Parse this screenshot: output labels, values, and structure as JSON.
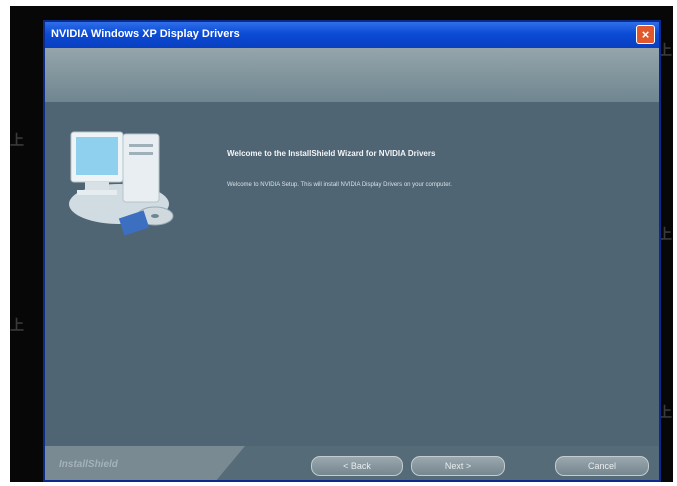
{
  "window": {
    "title": "NVIDIA Windows XP Display Drivers",
    "close_glyph": "×"
  },
  "welcome": {
    "title": "Welcome to the InstallShield Wizard for NVIDIA Drivers",
    "body": "Welcome to NVIDIA Setup. This will install NVIDIA Display Drivers on your computer."
  },
  "footer": {
    "brand": "InstallShield",
    "back_label": "< Back",
    "next_label": "Next >",
    "cancel_label": "Cancel"
  },
  "icons": {
    "computer": "computer-cd-icon",
    "close": "close-icon"
  },
  "colors": {
    "title_bar": "#0b4bd6",
    "panel": "#4f6573",
    "banner": "#8a9ca3",
    "close_button": "#e0582c"
  }
}
